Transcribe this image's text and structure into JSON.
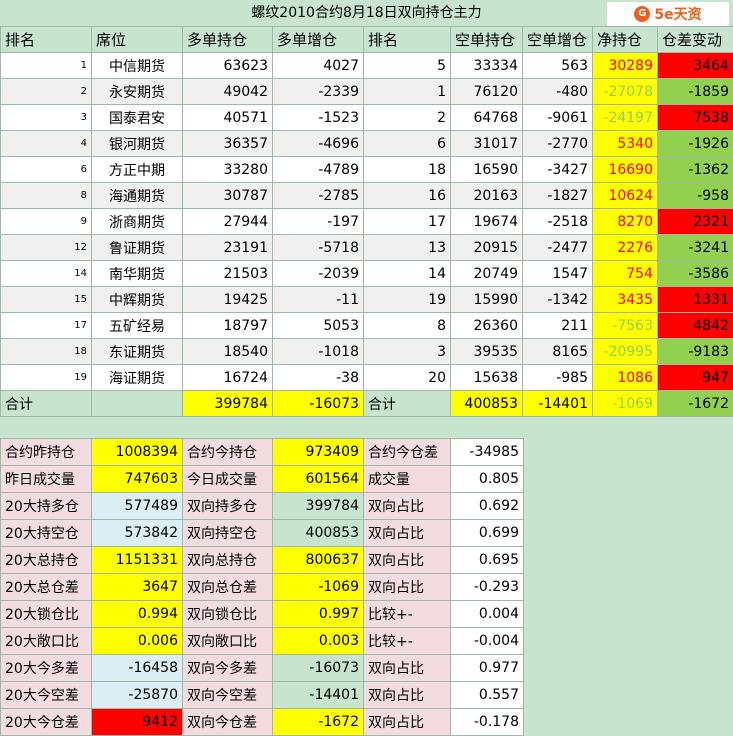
{
  "title": "螺纹2010合约8月18日双向持仓主力",
  "logo": {
    "icon": "G",
    "text": "5e天资"
  },
  "headers": [
    "排名",
    "席位",
    "多单持仓",
    "多单增仓",
    "排名",
    "空单持仓",
    "空单增仓",
    "净持仓",
    "仓差变动"
  ],
  "rows": [
    {
      "rank": "1",
      "seat": "中信期货",
      "long": "63623",
      "long_chg": "4027",
      "srank": "5",
      "short": "33334",
      "short_chg": "563",
      "net": "30289",
      "net_cls": "txt-red",
      "diff": "3464",
      "diff_cls": "red"
    },
    {
      "rank": "2",
      "seat": "永安期货",
      "long": "49042",
      "long_chg": "-2339",
      "srank": "1",
      "short": "76120",
      "short_chg": "-480",
      "net": "-27078",
      "net_cls": "txt-grn",
      "diff": "-1859",
      "diff_cls": "grn"
    },
    {
      "rank": "3",
      "seat": "国泰君安",
      "long": "40571",
      "long_chg": "-1523",
      "srank": "2",
      "short": "64768",
      "short_chg": "-9061",
      "net": "-24197",
      "net_cls": "txt-grn",
      "diff": "7538",
      "diff_cls": "red"
    },
    {
      "rank": "4",
      "seat": "银河期货",
      "long": "36357",
      "long_chg": "-4696",
      "srank": "6",
      "short": "31017",
      "short_chg": "-2770",
      "net": "5340",
      "net_cls": "txt-red",
      "diff": "-1926",
      "diff_cls": "grn"
    },
    {
      "rank": "6",
      "seat": "方正中期",
      "long": "33280",
      "long_chg": "-4789",
      "srank": "18",
      "short": "16590",
      "short_chg": "-3427",
      "net": "16690",
      "net_cls": "txt-red",
      "diff": "-1362",
      "diff_cls": "grn"
    },
    {
      "rank": "8",
      "seat": "海通期货",
      "long": "30787",
      "long_chg": "-2785",
      "srank": "16",
      "short": "20163",
      "short_chg": "-1827",
      "net": "10624",
      "net_cls": "txt-red",
      "diff": "-958",
      "diff_cls": "grn"
    },
    {
      "rank": "9",
      "seat": "浙商期货",
      "long": "27944",
      "long_chg": "-197",
      "srank": "17",
      "short": "19674",
      "short_chg": "-2518",
      "net": "8270",
      "net_cls": "txt-red",
      "diff": "2321",
      "diff_cls": "red"
    },
    {
      "rank": "12",
      "seat": "鲁证期货",
      "long": "23191",
      "long_chg": "-5718",
      "srank": "13",
      "short": "20915",
      "short_chg": "-2477",
      "net": "2276",
      "net_cls": "txt-red",
      "diff": "-3241",
      "diff_cls": "grn"
    },
    {
      "rank": "14",
      "seat": "南华期货",
      "long": "21503",
      "long_chg": "-2039",
      "srank": "14",
      "short": "20749",
      "short_chg": "1547",
      "net": "754",
      "net_cls": "txt-red",
      "diff": "-3586",
      "diff_cls": "grn"
    },
    {
      "rank": "15",
      "seat": "中辉期货",
      "long": "19425",
      "long_chg": "-11",
      "srank": "19",
      "short": "15990",
      "short_chg": "-1342",
      "net": "3435",
      "net_cls": "txt-red",
      "diff": "1331",
      "diff_cls": "red"
    },
    {
      "rank": "17",
      "seat": "五矿经易",
      "long": "18797",
      "long_chg": "5053",
      "srank": "8",
      "short": "26360",
      "short_chg": "211",
      "net": "-7563",
      "net_cls": "txt-grn",
      "diff": "4842",
      "diff_cls": "red"
    },
    {
      "rank": "18",
      "seat": "东证期货",
      "long": "18540",
      "long_chg": "-1018",
      "srank": "3",
      "short": "39535",
      "short_chg": "8165",
      "net": "-20995",
      "net_cls": "txt-grn",
      "diff": "-9183",
      "diff_cls": "grn"
    },
    {
      "rank": "19",
      "seat": "海证期货",
      "long": "16724",
      "long_chg": "-38",
      "srank": "20",
      "short": "15638",
      "short_chg": "-985",
      "net": "1086",
      "net_cls": "txt-red",
      "diff": "947",
      "diff_cls": "red"
    }
  ],
  "total": {
    "label": "合计",
    "long": "399784",
    "long_chg": "-16073",
    "label2": "合计",
    "short": "400853",
    "short_chg": "-14401",
    "net": "-1069",
    "diff": "-1672"
  },
  "summary": [
    {
      "a": "合约昨持仓",
      "av": "1008394",
      "b": "合约今持仓",
      "bv": "973409",
      "c": "合约今仓差",
      "cv": "-34985",
      "row_cls": "pink",
      "av_cls": "yel",
      "bv_cls": "yel"
    },
    {
      "a": "昨日成交量",
      "av": "747603",
      "b": "今日成交量",
      "bv": "601564",
      "c": "成交量",
      "cv": "0.805",
      "row_cls": "pink",
      "av_cls": "yel",
      "bv_cls": "yel"
    },
    {
      "a": "20大持多仓",
      "av": "577489",
      "b": "双向持多仓",
      "bv": "399784",
      "c": "双向占比",
      "cv": "0.692",
      "row_cls": "pink",
      "av_cls": "lblue",
      "bv_cls": "mint"
    },
    {
      "a": "20大持空仓",
      "av": "573842",
      "b": "双向持空仓",
      "bv": "400853",
      "c": "双向占比",
      "cv": "0.699",
      "row_cls": "pink",
      "av_cls": "lblue",
      "bv_cls": "mint"
    },
    {
      "a": "20大总持仓",
      "av": "1151331",
      "b": "双向总持仓",
      "bv": "800637",
      "c": "双向占比",
      "cv": "0.695",
      "row_cls": "pink",
      "av_cls": "yel",
      "bv_cls": "yel"
    },
    {
      "a": "20大总仓差",
      "av": "3647",
      "b": "双向总仓差",
      "bv": "-1069",
      "c": "双向占比",
      "cv": "-0.293",
      "row_cls": "pink",
      "av_cls": "yel",
      "bv_cls": "yel"
    },
    {
      "a": "20大锁仓比",
      "av": "0.994",
      "b": "双向锁仓比",
      "bv": "0.997",
      "c": "比较+-",
      "cv": "0.004",
      "row_cls": "pink",
      "av_cls": "yel",
      "bv_cls": "yel"
    },
    {
      "a": "20大敞口比",
      "av": "0.006",
      "b": "双向敞口比",
      "bv": "0.003",
      "c": "比较+-",
      "cv": "-0.004",
      "row_cls": "pink",
      "av_cls": "yel",
      "bv_cls": "yel"
    },
    {
      "a": "20大今多差",
      "av": "-16458",
      "b": "双向今多差",
      "bv": "-16073",
      "c": "双向占比",
      "cv": "0.977",
      "row_cls": "pink",
      "av_cls": "lblue",
      "bv_cls": "mint"
    },
    {
      "a": "20大今空差",
      "av": "-25870",
      "b": "双向今空差",
      "bv": "-14401",
      "c": "双向占比",
      "cv": "0.557",
      "row_cls": "pink",
      "av_cls": "lblue",
      "bv_cls": "mint"
    },
    {
      "a": "20大今仓差",
      "av": "9412",
      "b": "双向今仓差",
      "bv": "-1672",
      "c": "双向占比",
      "cv": "-0.178",
      "row_cls": "pink",
      "av_cls": "red",
      "bv_cls": "yel"
    }
  ]
}
